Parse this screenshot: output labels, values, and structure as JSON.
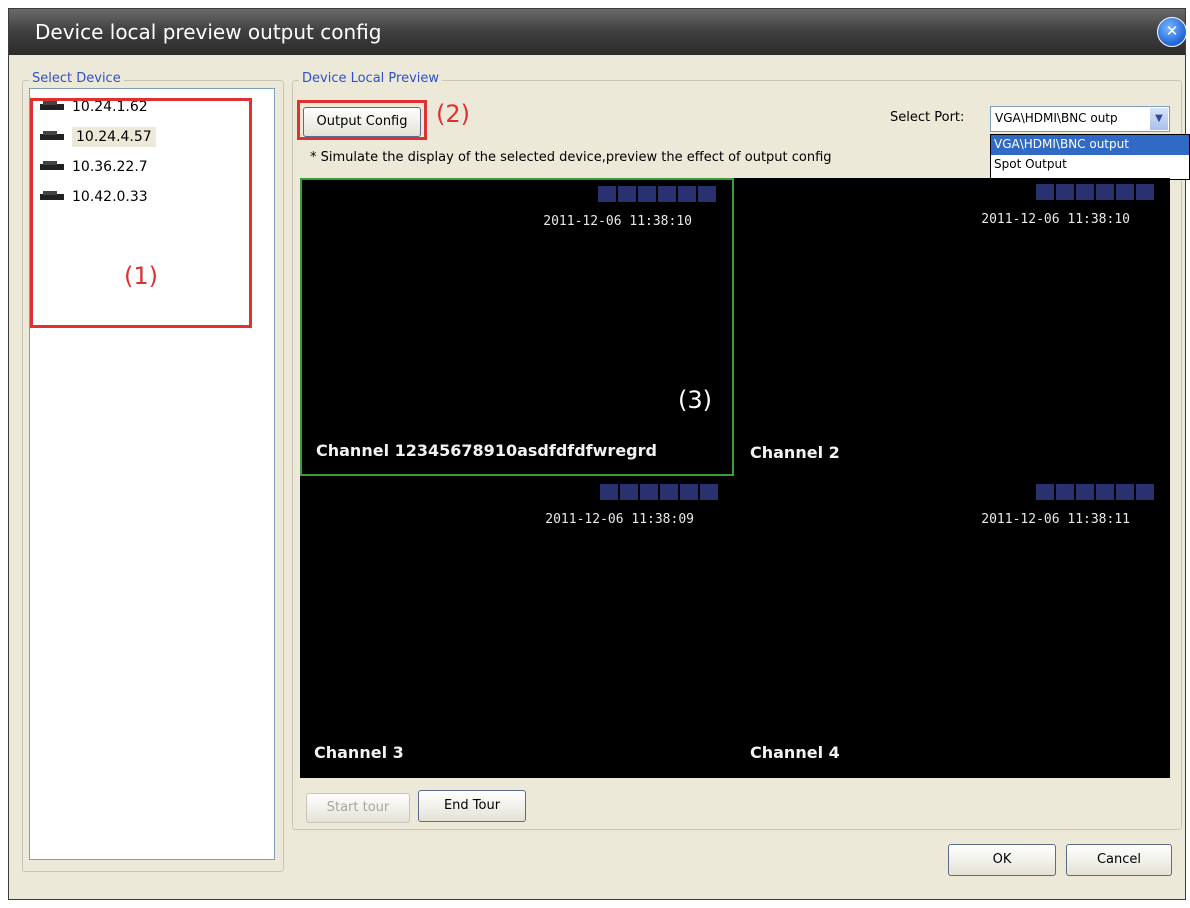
{
  "window": {
    "title": "Device local preview output config",
    "close_icon": "close-icon"
  },
  "select_device": {
    "label": "Select Device",
    "devices": [
      "10.24.1.62",
      "10.24.4.57",
      "10.36.22.7",
      "10.42.0.33"
    ],
    "selected": "10.24.4.57"
  },
  "preview_group": {
    "label": "Device Local Preview"
  },
  "toolbar": {
    "output_config": "Output Config"
  },
  "port": {
    "label": "Select Port:",
    "value": "VGA\\HDMI\\BNC outp",
    "options": [
      "VGA\\HDMI\\BNC output",
      "Spot Output"
    ],
    "selected_option": "VGA\\HDMI\\BNC output"
  },
  "hint": "* Simulate the display of the selected device,preview the effect of  output config",
  "channels": [
    {
      "name": "Channel 12345678910asdfdfdfwregrd",
      "time": "2011-12-06 11:38:10"
    },
    {
      "name": "Channel 2",
      "time": "2011-12-06 11:38:10"
    },
    {
      "name": "Channel 3",
      "time": "2011-12-06 11:38:09"
    },
    {
      "name": "Channel 4",
      "time": "2011-12-06 11:38:11"
    }
  ],
  "tour": {
    "start": "Start tour",
    "end": "End Tour"
  },
  "footer": {
    "ok": "OK",
    "cancel": "Cancel"
  },
  "annotations": {
    "a1": "(1)",
    "a2": "(2)",
    "a3": "(3)"
  },
  "colors": {
    "annotation": "#e03030",
    "selected_tile": "#3a9b3a",
    "group_label": "#3050c8"
  }
}
